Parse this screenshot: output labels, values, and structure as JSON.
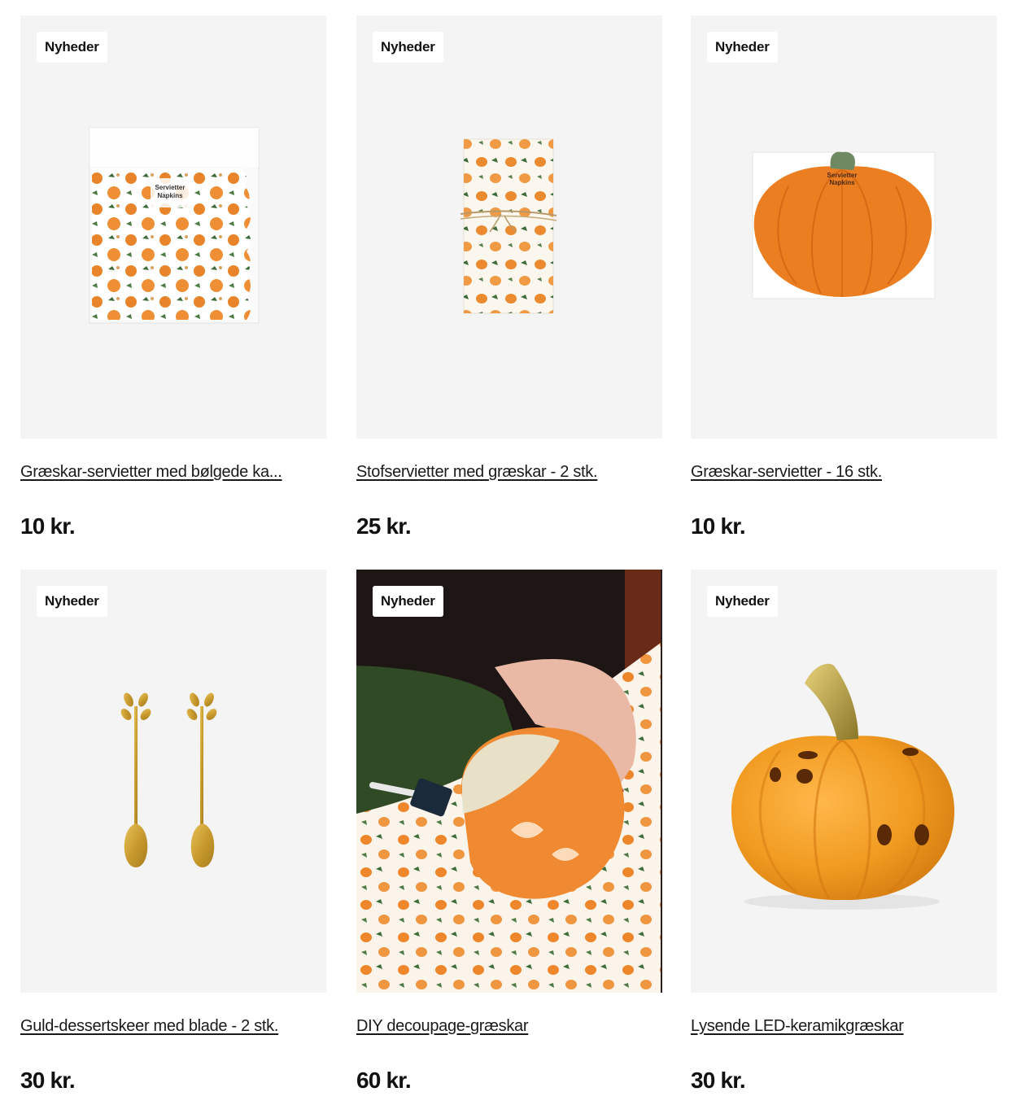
{
  "products": [
    {
      "badge": "Nyheder",
      "title": "Græskar-servietter med bølgede ka...",
      "price": "10 kr.",
      "image": "napkins-wavy-edge-pack"
    },
    {
      "badge": "Nyheder",
      "title": "Stofservietter med græskar - 2 stk.",
      "price": "25 kr.",
      "image": "cloth-napkins-tied"
    },
    {
      "badge": "Nyheder",
      "title": "Græskar-servietter - 16 stk.",
      "price": "10 kr.",
      "image": "pumpkin-shaped-napkins"
    },
    {
      "badge": "Nyheder",
      "title": "Guld-dessertskeer med blade - 2 stk.",
      "price": "30 kr.",
      "image": "gold-leaf-spoons"
    },
    {
      "badge": "Nyheder",
      "title": "DIY decoupage-græskar",
      "price": "60 kr.",
      "image": "decoupage-pumpkin-photo"
    },
    {
      "badge": "Nyheder",
      "title": "Lysende LED-keramikgræskar",
      "price": "30 kr.",
      "image": "ceramic-led-pumpkin"
    }
  ],
  "packaging_text": {
    "napkins_label_1": "Servietter",
    "napkins_label_2": "Napkins"
  },
  "colors": {
    "pumpkin_orange": "#e8842a",
    "leaf_green": "#3d6b3a",
    "gold": "#c9a032",
    "card_bg": "#f4f4f4"
  }
}
